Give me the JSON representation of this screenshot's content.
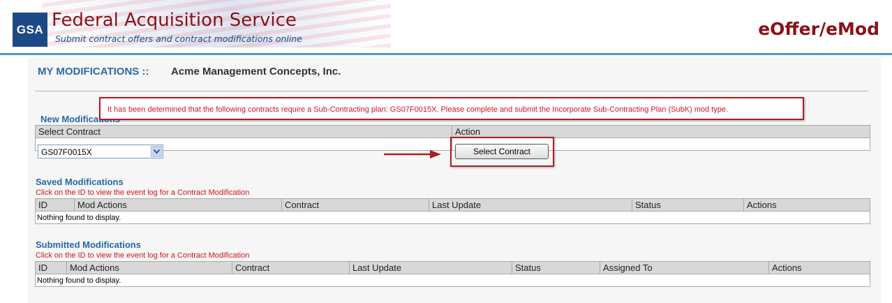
{
  "header": {
    "logo_text": "GSA",
    "agency_title": "Federal Acquisition Service",
    "tagline": "Submit contract offers and contract modifications online",
    "app_title": "eOffer/eMod",
    "accent_color": "#8a1217",
    "brand_blue": "#1d4a86"
  },
  "page": {
    "heading": "MY MODIFICATIONS ::",
    "company": "Acme Management Concepts, Inc."
  },
  "alert": {
    "message": "It has been determined that the following contracts require a Sub-Contracting plan: GS07F0015X. Please complete and submit the Incorporate Sub-Contracting Plan (SubK) mod type."
  },
  "new_mods": {
    "title": "New Modifications",
    "col_select": "Select Contract",
    "col_action": "Action",
    "selected_contract": "GS07F0015X",
    "button_label": "Select Contract"
  },
  "saved_mods": {
    "title": "Saved Modifications",
    "hint": "Click on the ID to view the event log for a Contract Modification",
    "columns": [
      "ID",
      "Mod Actions",
      "Contract",
      "Last Update",
      "Status",
      "Actions"
    ],
    "empty_text": "Nothing found to display."
  },
  "submitted_mods": {
    "title": "Submitted Modifications",
    "hint": "Click on the ID to view the event log for a Contract Modification",
    "columns": [
      "ID",
      "Mod Actions",
      "Contract",
      "Last Update",
      "Status",
      "Assigned To",
      "Actions"
    ],
    "empty_text": "Nothing found to display."
  }
}
